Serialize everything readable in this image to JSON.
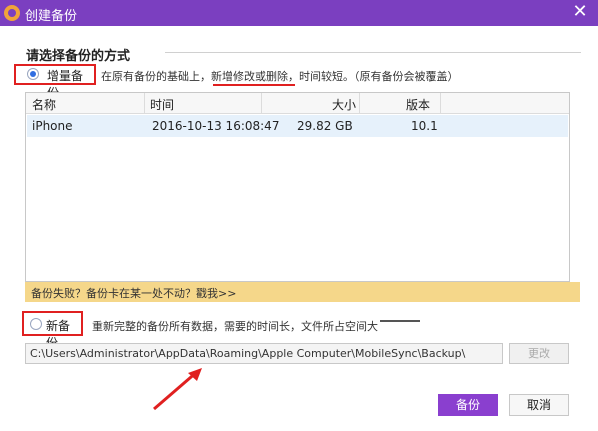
{
  "window": {
    "title": "创建备份",
    "accent_color": "#7b3fc0"
  },
  "section": {
    "title": "请选择备份的方式"
  },
  "option_incremental": {
    "label": "增量备份",
    "checked": true,
    "description": "在原有备份的基础上，新增修改或删除，时间较短。（原有备份会被覆盖）"
  },
  "table": {
    "headers": [
      "名称",
      "时间",
      "大小",
      "版本"
    ],
    "rows": [
      {
        "name": "iPhone",
        "time": "2016-10-13 16:08:47",
        "size": "29.82 GB",
        "version": "10.1"
      }
    ]
  },
  "banner": {
    "text": "备份失败？备份卡在某一处不动？戳我>>"
  },
  "option_new": {
    "label": "新备份",
    "checked": false,
    "description": "重新完整的备份所有数据，需要的时间长，文件所占空间大"
  },
  "path": {
    "value": "C:\\Users\\Administrator\\AppData\\Roaming\\Apple Computer\\MobileSync\\Backup\\"
  },
  "buttons": {
    "browse": "更改",
    "backup": "备份",
    "cancel": "取消"
  }
}
